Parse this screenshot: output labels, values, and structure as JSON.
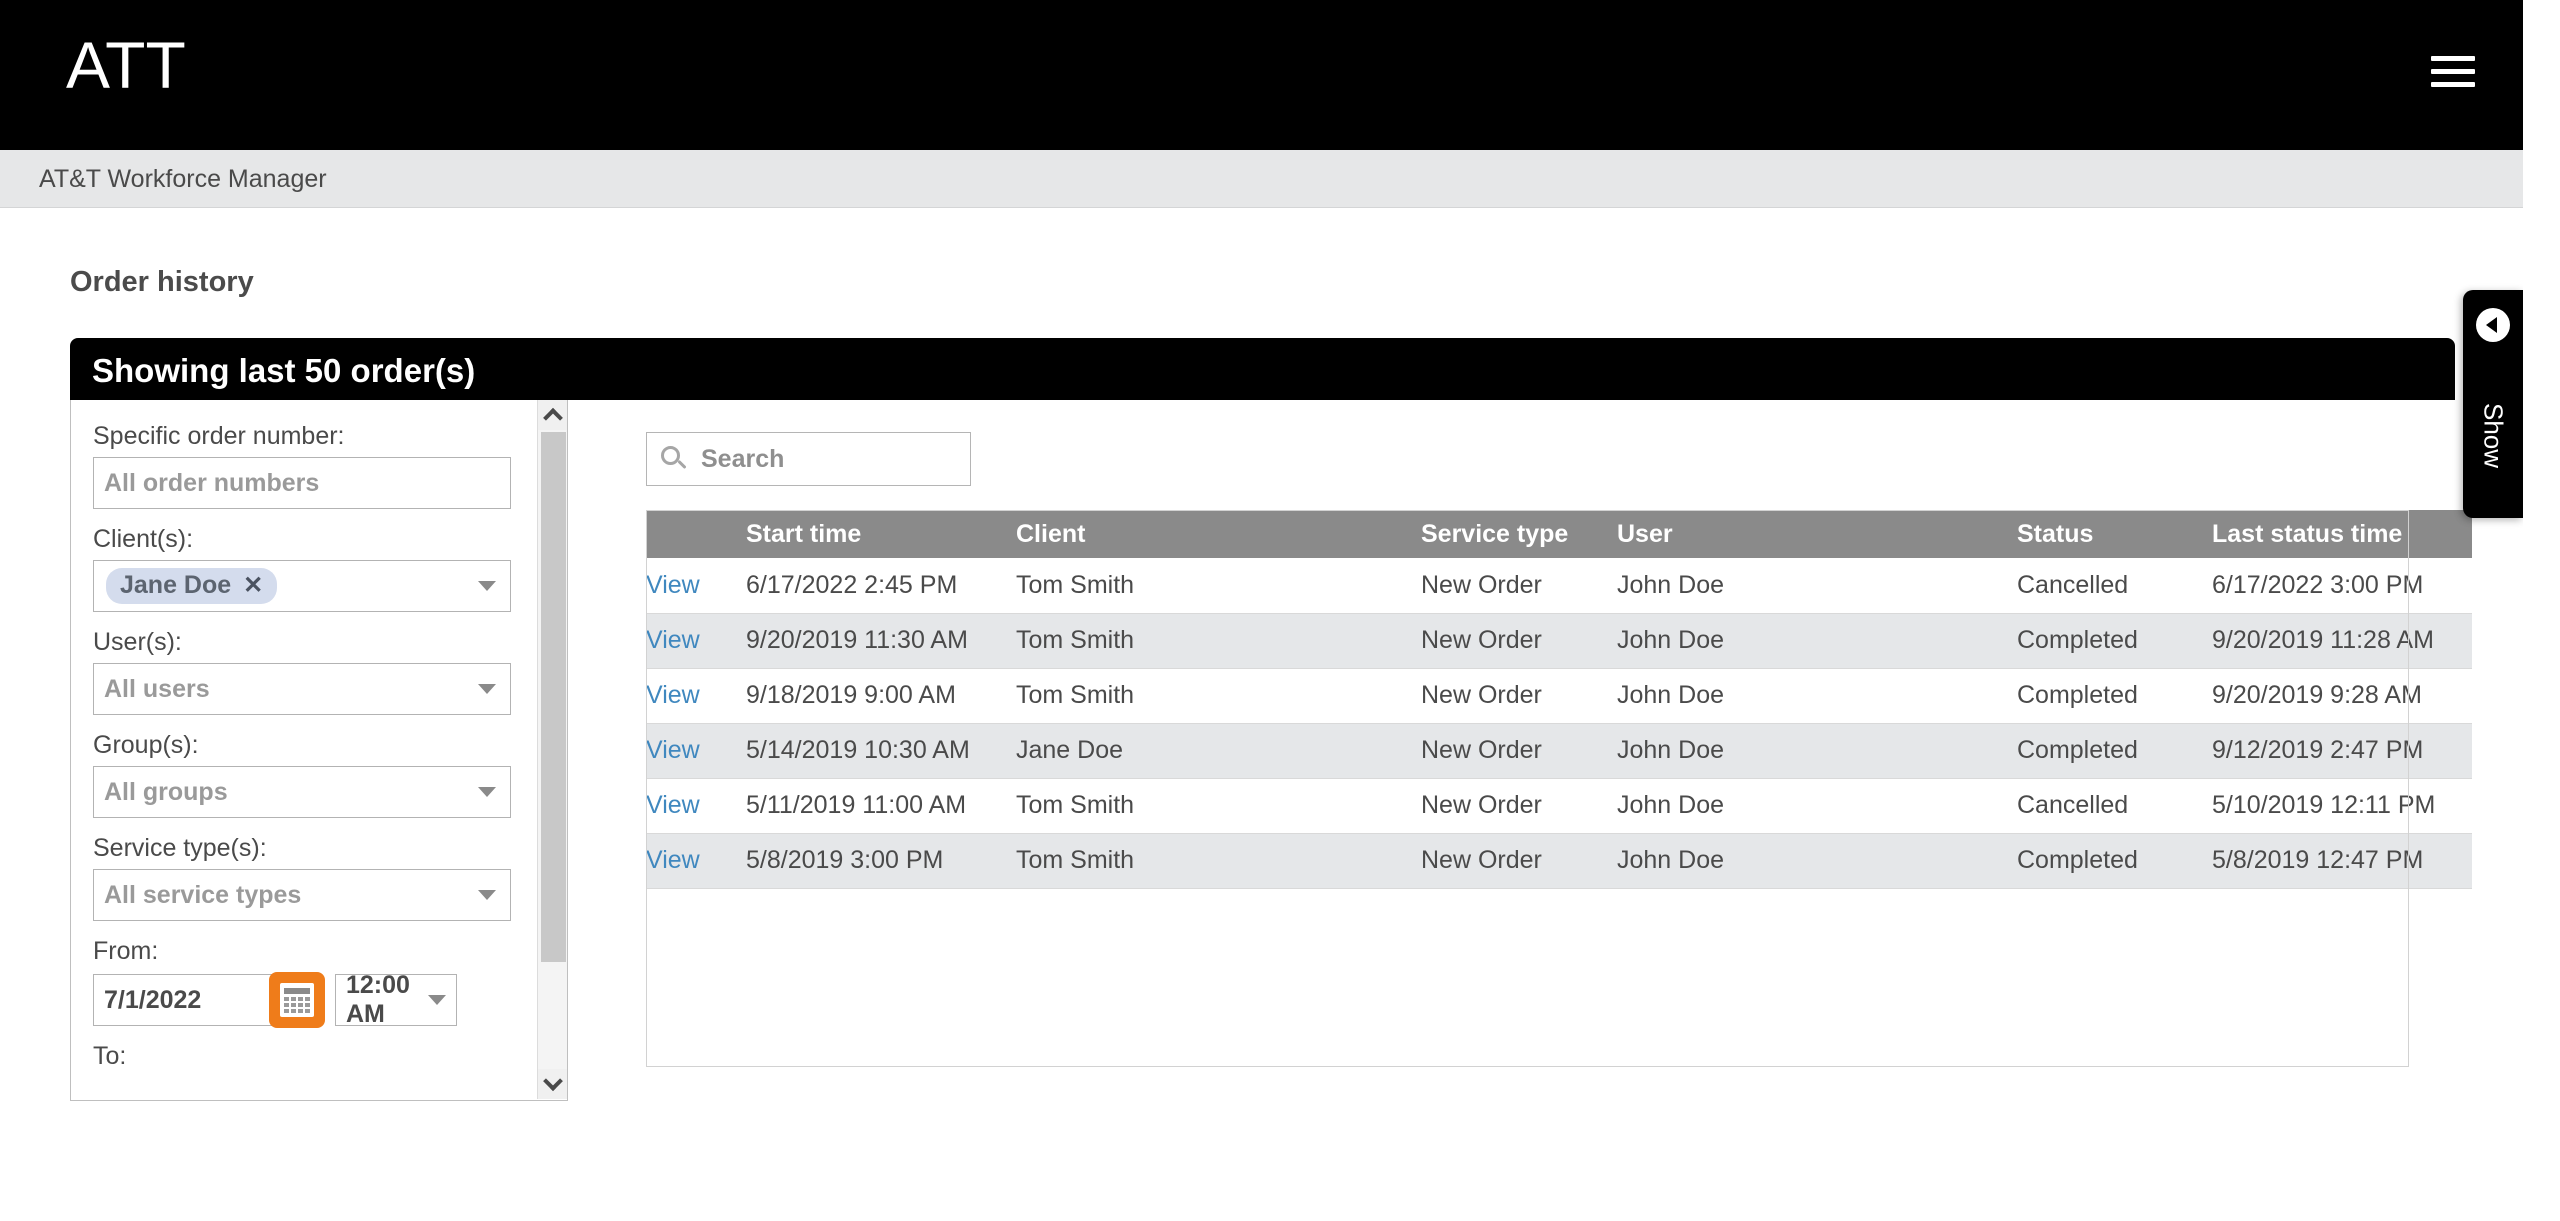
{
  "appbar": {
    "logo_text": "ATT",
    "menu_icon": "hamburger-icon"
  },
  "breadcrumb": {
    "text": "AT&T Workforce Manager"
  },
  "page": {
    "title": "Order history"
  },
  "card": {
    "header_title": "Showing last 50 order(s)"
  },
  "filters": {
    "order_number": {
      "label": "Specific order number:",
      "placeholder": "All order numbers",
      "value": ""
    },
    "clients": {
      "label": "Client(s):",
      "selected_chip": "Jane Doe",
      "chip_remove": "✕"
    },
    "users": {
      "label": "User(s):",
      "placeholder": "All users"
    },
    "groups": {
      "label": "Group(s):",
      "placeholder": "All groups"
    },
    "service_types": {
      "label": "Service type(s):",
      "placeholder": "All service types"
    },
    "from": {
      "label": "From:",
      "date_value": "7/1/2022",
      "time_value": "12:00 AM",
      "calendar_icon": "calendar-icon"
    },
    "to": {
      "label": "To:"
    }
  },
  "search": {
    "placeholder": "Search",
    "value": "",
    "icon": "search-icon"
  },
  "table": {
    "columns": [
      "",
      "Start time",
      "Client",
      "Service type",
      "User",
      "Status",
      "Last status time"
    ],
    "view_label": "View",
    "rows": [
      {
        "view": "View",
        "start_time": "6/17/2022 2:45 PM",
        "client": "Tom Smith",
        "service_type": "New Order",
        "user": "John Doe",
        "status": "Cancelled",
        "last_status_time": "6/17/2022 3:00 PM"
      },
      {
        "view": "View",
        "start_time": "9/20/2019 11:30 AM",
        "client": "Tom Smith",
        "service_type": "New Order",
        "user": "John Doe",
        "status": "Completed",
        "last_status_time": "9/20/2019 11:28 AM"
      },
      {
        "view": "View",
        "start_time": "9/18/2019 9:00 AM",
        "client": "Tom Smith",
        "service_type": "New Order",
        "user": "John Doe",
        "status": "Completed",
        "last_status_time": "9/20/2019 9:28 AM"
      },
      {
        "view": "View",
        "start_time": "5/14/2019 10:30 AM",
        "client": "Jane Doe",
        "service_type": "New Order",
        "user": "John Doe",
        "status": "Completed",
        "last_status_time": "9/12/2019 2:47 PM"
      },
      {
        "view": "View",
        "start_time": "5/11/2019 11:00 AM",
        "client": "Tom Smith",
        "service_type": "New Order",
        "user": "John Doe",
        "status": "Cancelled",
        "last_status_time": "5/10/2019 12:11 PM"
      },
      {
        "view": "View",
        "start_time": "5/8/2019 3:00 PM",
        "client": "Tom Smith",
        "service_type": "New Order",
        "user": "John Doe",
        "status": "Completed",
        "last_status_time": "5/8/2019 12:47 PM"
      }
    ]
  },
  "show_tab": {
    "label": "Show",
    "icon": "arrow-left-circle-icon"
  },
  "colors": {
    "accent_orange": "#ef7c1a",
    "link_blue": "#4088bf",
    "header_black": "#000000",
    "table_header_gray": "#8a8a8a",
    "chip_blue": "#d4dced"
  }
}
